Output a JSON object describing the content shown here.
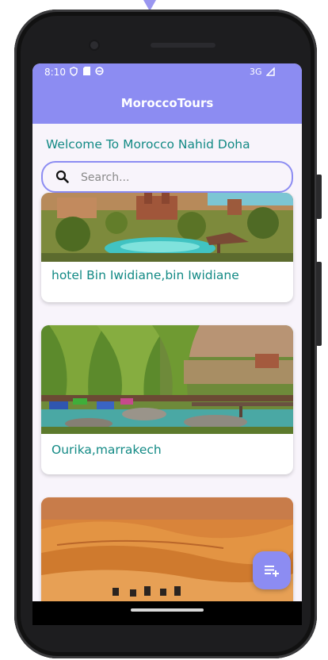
{
  "status_bar": {
    "time": "8:10",
    "network": "3G"
  },
  "app": {
    "title": "MoroccoTours",
    "welcome": "Welcome To Morocco Nahid Doha"
  },
  "search": {
    "placeholder": "Search..."
  },
  "cards": [
    {
      "caption": "hotel Bin Iwidiane,bin Iwidiane"
    },
    {
      "caption": "Ourika,marrakech"
    },
    {
      "caption": ""
    }
  ],
  "colors": {
    "accent": "#8c8cf2",
    "caption_teal": "#138a85",
    "background": "#f8f4fb"
  },
  "icons": {
    "search": "search-icon",
    "fab": "playlist-add-icon"
  }
}
